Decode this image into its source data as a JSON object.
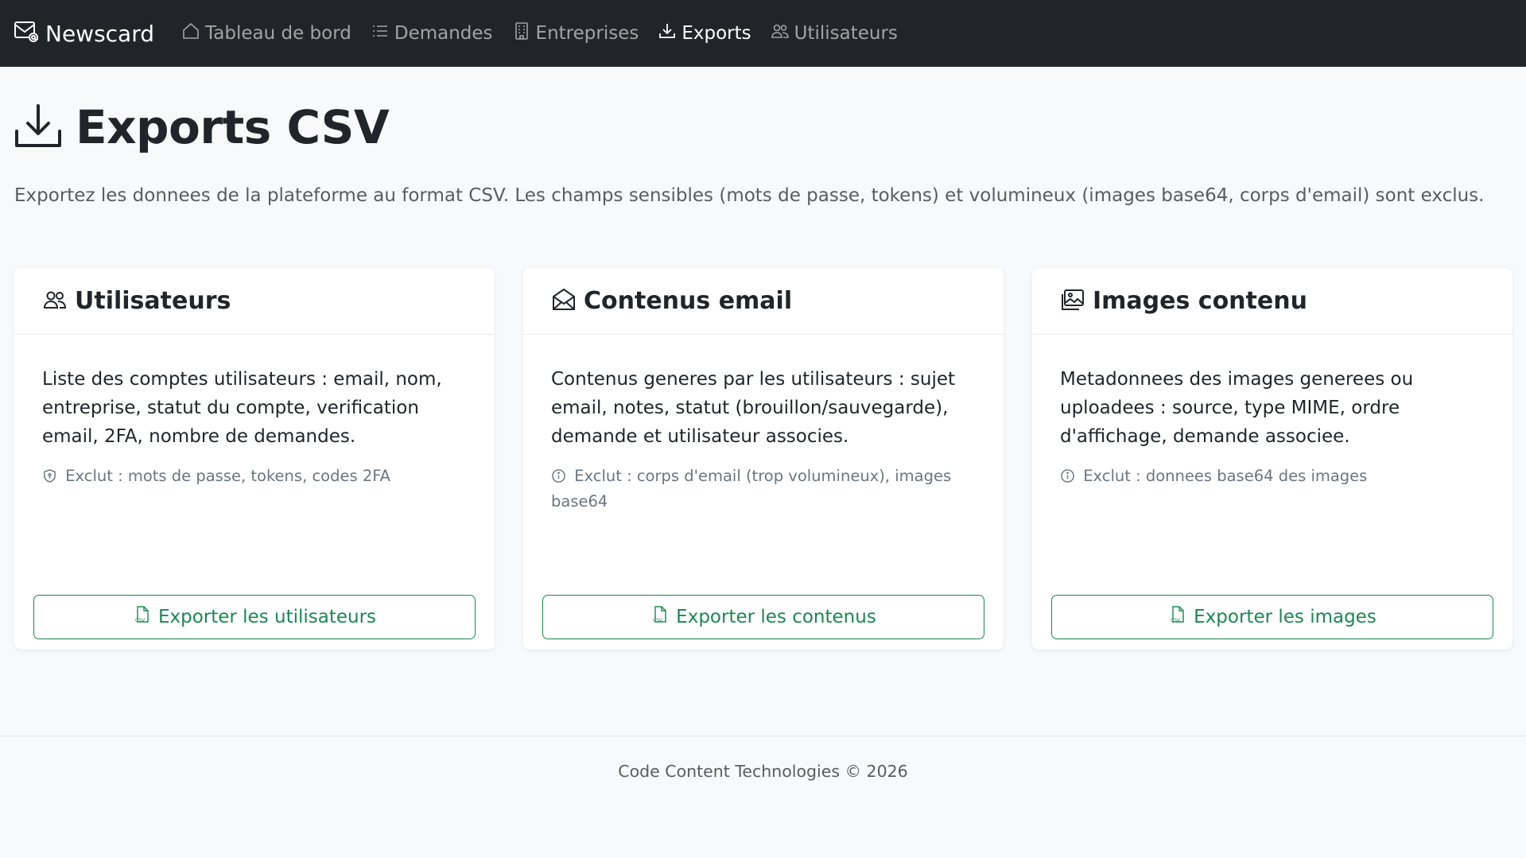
{
  "navbar": {
    "brand": "Newscard",
    "items": [
      {
        "label": "Tableau de bord",
        "icon": "house-icon",
        "active": false
      },
      {
        "label": "Demandes",
        "icon": "list-icon",
        "active": false
      },
      {
        "label": "Entreprises",
        "icon": "building-icon",
        "active": false
      },
      {
        "label": "Exports",
        "icon": "download-icon",
        "active": true
      },
      {
        "label": "Utilisateurs",
        "icon": "people-icon",
        "active": false
      }
    ]
  },
  "header": {
    "title": "Exports CSV",
    "description": "Exportez les donnees de la plateforme au format CSV. Les champs sensibles (mots de passe, tokens) et volumineux (images base64, corps d'email) sont exclus."
  },
  "cards": [
    {
      "title": "Utilisateurs",
      "icon": "people-icon",
      "text": "Liste des comptes utilisateurs : email, nom, entreprise, statut du compte, verification email, 2FA, nombre de demandes.",
      "note_icon": "shield-icon",
      "note": "Exclut : mots de passe, tokens, codes 2FA",
      "button": "Exporter les utilisateurs"
    },
    {
      "title": "Contenus email",
      "icon": "envelope-open-icon",
      "text": "Contenus generes par les utilisateurs : sujet email, notes, statut (brouillon/sauvegarde), demande et utilisateur associes.",
      "note_icon": "info-circle-icon",
      "note": "Exclut : corps d'email (trop volumineux), images base64",
      "button": "Exporter les contenus"
    },
    {
      "title": "Images contenu",
      "icon": "images-icon",
      "text": "Metadonnees des images generees ou uploadees : source, type MIME, ordre d'affichage, demande associee.",
      "note_icon": "info-circle-icon",
      "note": "Exclut : donnees base64 des images",
      "button": "Exporter les images"
    }
  ],
  "footer": {
    "text": "Code Content Technologies © 2026"
  },
  "colors": {
    "navbar_bg": "#212529",
    "page_bg": "#f8f9fa",
    "button_accent": "#198754"
  }
}
